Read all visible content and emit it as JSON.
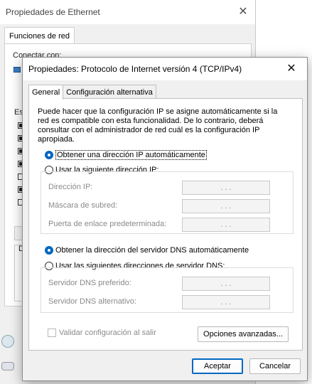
{
  "background_window": {
    "title": "Propiedades de Ethernet",
    "tab": "Funciones de red",
    "connect_label": "Conectar con:",
    "items_label": "Esta",
    "group_label": "D"
  },
  "dialog": {
    "title": "Propiedades: Protocolo de Internet versión 4 (TCP/IPv4)",
    "close_glyph": "✕",
    "tabs": [
      {
        "label": "General",
        "active": true
      },
      {
        "label": "Configuración alternativa",
        "active": false
      }
    ],
    "description": "Puede hacer que la configuración IP se asigne automáticamente si la red es compatible con esta funcionalidad. De lo contrario, deberá consultar con el administrador de red cuál es la configuración IP apropiada.",
    "ip_auto_label": "Obtener una dirección IP automáticamente",
    "ip_manual_label": "Usar la siguiente dirección IP:",
    "ip_fields": [
      {
        "label": "Dirección IP:",
        "value": ".      .      ."
      },
      {
        "label": "Máscara de subred:",
        "value": ".      .      ."
      },
      {
        "label": "Puerta de enlace predeterminada:",
        "value": ".      .      ."
      }
    ],
    "dns_auto_label": "Obtener la dirección del servidor DNS automáticamente",
    "dns_manual_label": "Usar las siguientes direcciones de servidor DNS:",
    "dns_fields": [
      {
        "label": "Servidor DNS preferido:",
        "value": ".      .      ."
      },
      {
        "label": "Servidor DNS alternativo:",
        "value": ".      .      ."
      }
    ],
    "validate_label": "Validar configuración al salir",
    "advanced_button": "Opciones avanzadas...",
    "accept_button": "Aceptar",
    "cancel_button": "Cancelar",
    "selected_ip_mode": "automatic",
    "selected_dns_mode": "automatic",
    "accent_color": "#0067c0"
  }
}
